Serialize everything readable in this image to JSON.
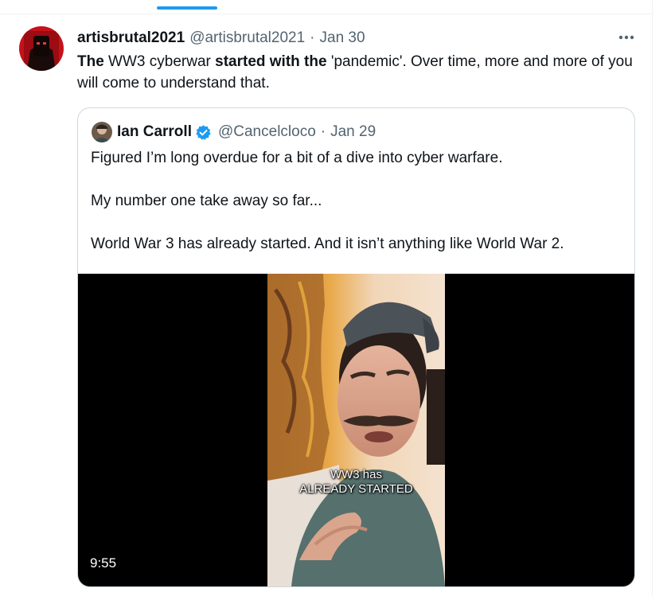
{
  "tweet": {
    "display_name": "artisbrutal2021",
    "handle": "@artisbrutal2021",
    "separator": "·",
    "date": "Jan 30",
    "more_icon": "more-horizontal-icon",
    "text_segments": [
      {
        "text": "The",
        "bold": true
      },
      {
        "text": " WW3 cyberwar ",
        "bold": false
      },
      {
        "text": "started with the",
        "bold": true
      },
      {
        "text": " 'pandemic'.  Over time, more and more of you will come to understand that.",
        "bold": false
      }
    ]
  },
  "quote": {
    "display_name": "Ian Carroll",
    "verified_icon": "verified-badge-icon",
    "handle": "@Cancelcloco",
    "separator": "·",
    "date": "Jan 29",
    "paragraphs": [
      "Figured I’m long overdue for a bit of a dive into cyber warfare.",
      "My number one take away so far...",
      "World War 3 has already started. And it isn’t anything like World War 2."
    ],
    "video": {
      "caption_line1": "WW3 has",
      "caption_line2": "ALREADY STARTED",
      "duration": "9:55"
    }
  },
  "colors": {
    "accent": "#1d9bf0",
    "secondary_text": "#536471",
    "border": "#cfd9de",
    "verified": "#1d9bf0"
  }
}
